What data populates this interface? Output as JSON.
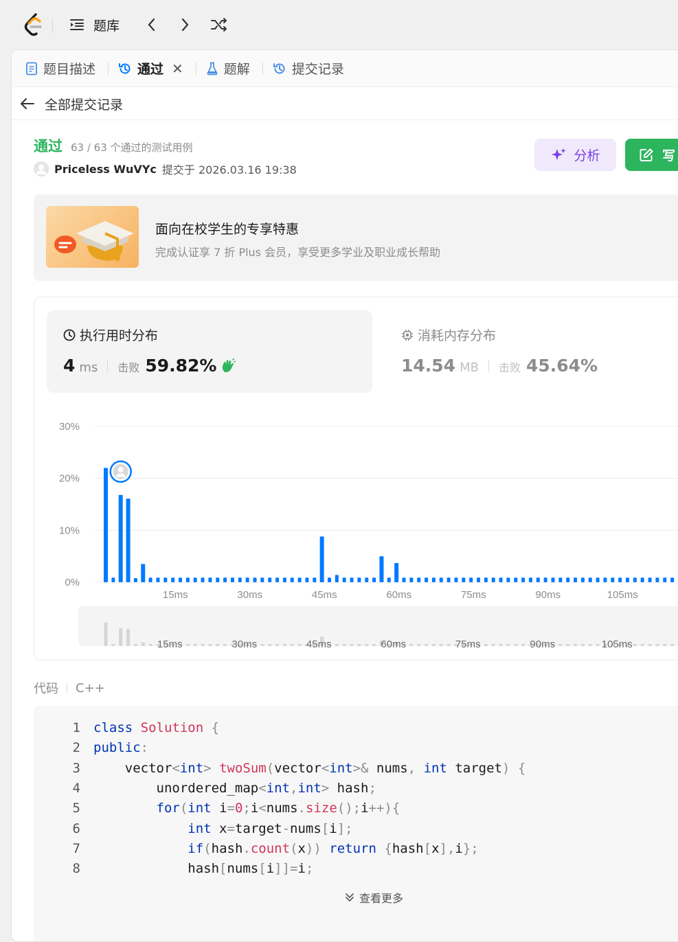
{
  "topbar": {
    "problem_bank": "题库"
  },
  "tabs": [
    {
      "label": "题目描述",
      "icon": "description-icon"
    },
    {
      "label": "通过",
      "icon": "history-icon",
      "active": true
    },
    {
      "label": "题解",
      "icon": "flask-icon"
    },
    {
      "label": "提交记录",
      "icon": "history-icon"
    }
  ],
  "back": {
    "label": "全部提交记录"
  },
  "submission": {
    "status": "通过",
    "cases": "63 / 63 个通过的测试用例",
    "user": "Priceless WuVYc",
    "submitted_at": "提交于 2026.03.16 19:38"
  },
  "buttons": {
    "analyze": "分析",
    "write": "写"
  },
  "promo": {
    "title": "面向在校学生的专享特惠",
    "subtitle": "完成认证享 7 折 Plus 会员，享受更多学业及职业成长帮助"
  },
  "runtime": {
    "title": "执行用时分布",
    "value": "4",
    "unit": "ms",
    "beat_label": "击败",
    "beat": "59.82%"
  },
  "memory": {
    "title": "消耗内存分布",
    "value": "14.54",
    "unit": "MB",
    "beat_label": "击败",
    "beat": "45.64%"
  },
  "chart_data": {
    "type": "bar",
    "ylim": [
      0,
      30
    ],
    "y_ticks": [
      "30%",
      "20%",
      "10%",
      "0%"
    ],
    "x_ticks": [
      "15ms",
      "30ms",
      "45ms",
      "60ms",
      "75ms",
      "90ms",
      "105ms"
    ],
    "x_tick_values": [
      15,
      30,
      45,
      60,
      75,
      90,
      105
    ],
    "bar_step_ms": 1.5,
    "x_start_ms": 1,
    "values": [
      22,
      0.9,
      16.8,
      16.1,
      0.8,
      3.5,
      0.9,
      0.9,
      0.9,
      0.9,
      0.9,
      0.9,
      0.9,
      0.9,
      0.9,
      0.9,
      0.9,
      0.9,
      0.9,
      0.9,
      0.9,
      0.9,
      0.9,
      0.9,
      0.9,
      0.9,
      0.9,
      0.9,
      0.9,
      8.8,
      0.9,
      1.4,
      0.9,
      0.9,
      0.9,
      0.9,
      0.9,
      5,
      0.9,
      3.7,
      0.9,
      0.9,
      0.9,
      0.9,
      0.9,
      0.9,
      0.9,
      0.9,
      0.9,
      0.9,
      0.9,
      0.9,
      0.9,
      0.9,
      0.9,
      0.9,
      0.9,
      0.9,
      0.9,
      0.9,
      0.9,
      0.9,
      0.9,
      0.9,
      0.9,
      0.9,
      0.9,
      0.9,
      0.9,
      0.9,
      0.9,
      0.9,
      0.9,
      0.9,
      0.9,
      0.9,
      0.9,
      0.9
    ],
    "highlight_index": 2,
    "bar_color": "#007aff",
    "grid": true
  },
  "code": {
    "label": "代码",
    "language": "C++",
    "show_more": "查看更多",
    "lines": [
      "1",
      "2",
      "3",
      "4",
      "5",
      "6",
      "7",
      "8"
    ]
  },
  "colors": {
    "accent_green": "#2db55d",
    "accent_purple": "#7b3fe4",
    "bar_blue": "#007aff"
  }
}
